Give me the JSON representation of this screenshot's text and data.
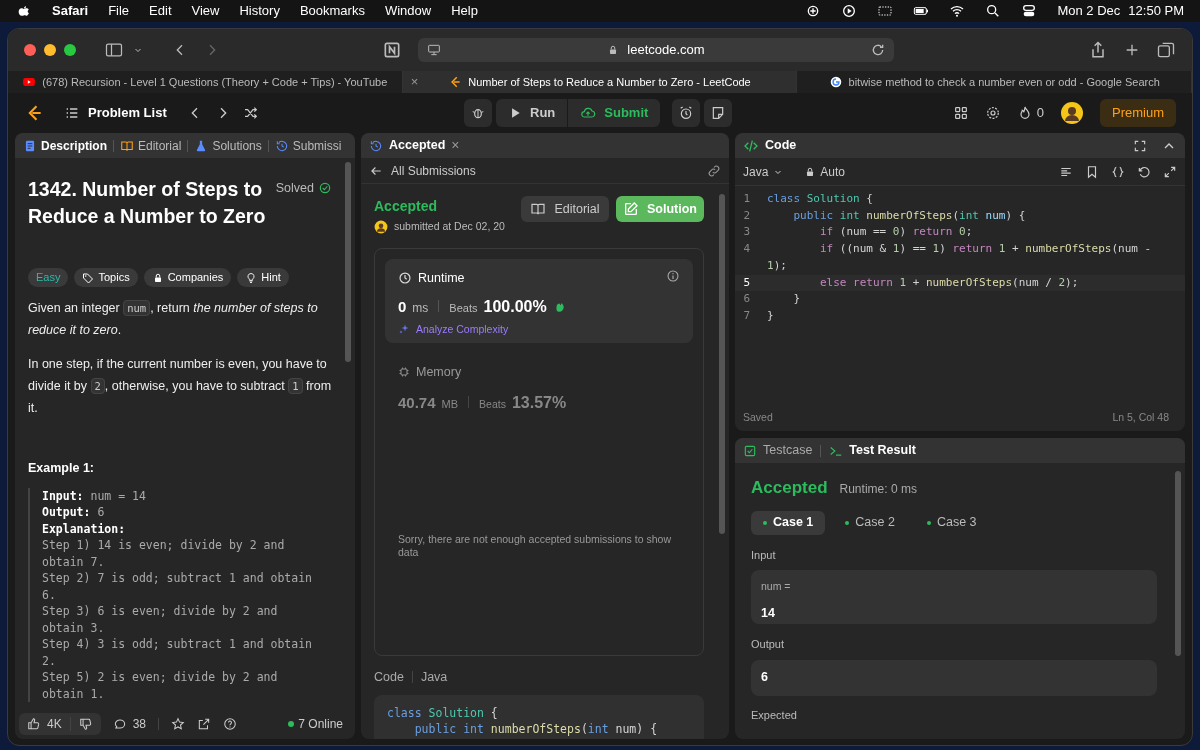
{
  "menu_bar": {
    "app": "Safari",
    "menus": [
      "File",
      "Edit",
      "View",
      "History",
      "Bookmarks",
      "Window",
      "Help"
    ],
    "date": "Mon 2 Dec",
    "time": "12:50 PM"
  },
  "browser": {
    "url": "leetcode.com",
    "tabs": [
      {
        "title": "(678) Recursion - Level 1 Questions (Theory + Code + Tips) - YouTube",
        "selected": false
      },
      {
        "title": "Number of Steps to Reduce a Number to Zero - LeetCode",
        "selected": true,
        "close": "×"
      },
      {
        "title": "bitwise method to check a number even or odd - Google Search",
        "selected": false
      }
    ]
  },
  "nav": {
    "problem_list": "Problem List",
    "run": "Run",
    "submit": "Submit",
    "streak": "0",
    "premium": "Premium"
  },
  "left_panel": {
    "tabs": [
      {
        "label": "Description",
        "selected": true
      },
      {
        "label": "Editorial",
        "selected": false
      },
      {
        "label": "Solutions",
        "selected": false
      },
      {
        "label": "Submissi",
        "selected": false
      }
    ],
    "title": "1342. Number of Steps to Reduce a Number to Zero",
    "status": "Solved",
    "badges": [
      {
        "kind": "difficulty",
        "label": "Easy"
      },
      {
        "kind": "topics",
        "label": "Topics"
      },
      {
        "kind": "companies",
        "label": "Companies"
      },
      {
        "kind": "hint",
        "label": "Hint"
      }
    ],
    "paragraphs": [
      [
        {
          "kind": "text",
          "text": "Given an integer "
        },
        {
          "kind": "code",
          "text": "num"
        },
        {
          "kind": "text",
          "text": ", return *the number of steps to reduce it to zero*."
        }
      ],
      [
        {
          "kind": "text",
          "text": "In one step, if the current number is even, you have to divide it by "
        },
        {
          "kind": "code",
          "text": "2"
        },
        {
          "kind": "text",
          "text": ", otherwise, you have to subtract "
        },
        {
          "kind": "code",
          "text": "1"
        },
        {
          "kind": "text",
          "text": " from it."
        }
      ]
    ],
    "example_title": "Example 1:",
    "example_lines": [
      {
        "label": "Input:",
        "text": " num = 14"
      },
      {
        "label": "Output:",
        "text": " 6"
      },
      {
        "label": "Explanation:"
      },
      {
        "text": "Step 1) 14 is even; divide by 2 and"
      },
      {
        "text": "obtain 7."
      },
      {
        "text": "Step 2) 7 is odd; subtract 1 and obtain"
      },
      {
        "text": "6."
      },
      {
        "text": "Step 3) 6 is even; divide by 2 and"
      },
      {
        "text": "obtain 3."
      },
      {
        "text": "Step 4) 3 is odd; subtract 1 and obtain"
      },
      {
        "text": "2."
      },
      {
        "text": "Step 5) 2 is even; divide by 2 and"
      },
      {
        "text": "obtain 1."
      }
    ],
    "footer": {
      "likes": "4K",
      "comments": "38",
      "online": "7 Online"
    }
  },
  "middle_panel": {
    "tab": "Accepted",
    "close": "×",
    "back": "All Submissions",
    "status": "Accepted",
    "submitted": "submitted at Dec 02, 20",
    "editorial": "Editorial",
    "solution": "Solution",
    "runtime": {
      "title": "Runtime",
      "value": "0",
      "unit": "ms",
      "beats_label": "Beats",
      "beats": "100.00%",
      "analyze": "Analyze Complexity"
    },
    "memory": {
      "title": "Memory",
      "value": "40.74",
      "unit": "MB",
      "beats_label": "Beats",
      "beats": "13.57%"
    },
    "notice": "Sorry, there are not enough accepted submissions to show data",
    "code_label": "Code",
    "language": "Java",
    "code_lines": [
      [
        {
          "kind": "keyword",
          "text": "class "
        },
        {
          "kind": "class",
          "text": "Solution"
        },
        {
          "kind": "plain",
          "text": " {"
        }
      ],
      [
        {
          "kind": "keyword",
          "text": "    public int "
        },
        {
          "kind": "function",
          "text": "numberOfSteps"
        },
        {
          "kind": "plain",
          "text": "("
        },
        {
          "kind": "keyword",
          "text": "int"
        },
        {
          "kind": "plain",
          "text": " num) {"
        }
      ]
    ]
  },
  "editor": {
    "title": "Code",
    "language": "Java",
    "mode": "Auto",
    "saved": "Saved",
    "cursor": "Ln 5, Col 48",
    "lines": [
      {
        "number": "1",
        "tokens": [
          {
            "kind": "keyword",
            "text": "class "
          },
          {
            "kind": "class",
            "text": "Solution"
          },
          {
            "kind": "plain",
            "text": " {"
          }
        ]
      },
      {
        "number": "2",
        "tokens": [
          {
            "kind": "keyword",
            "text": "    public "
          },
          {
            "kind": "class",
            "text": "int "
          },
          {
            "kind": "function",
            "text": "numberOfSteps"
          },
          {
            "kind": "plain",
            "text": "("
          },
          {
            "kind": "class",
            "text": "int "
          },
          {
            "kind": "variable",
            "text": "num"
          },
          {
            "kind": "plain",
            "text": ") {"
          }
        ]
      },
      {
        "number": "3",
        "tokens": [
          {
            "kind": "control",
            "text": "        if"
          },
          {
            "kind": "plain",
            "text": " (num == "
          },
          {
            "kind": "number",
            "text": "0"
          },
          {
            "kind": "plain",
            "text": ") "
          },
          {
            "kind": "control",
            "text": "return "
          },
          {
            "kind": "number",
            "text": "0"
          },
          {
            "kind": "plain",
            "text": ";"
          }
        ]
      },
      {
        "number": "4",
        "tokens": [
          {
            "kind": "control",
            "text": "        if"
          },
          {
            "kind": "plain",
            "text": " ((num & "
          },
          {
            "kind": "number",
            "text": "1"
          },
          {
            "kind": "plain",
            "text": ") == "
          },
          {
            "kind": "number",
            "text": "1"
          },
          {
            "kind": "plain",
            "text": ") "
          },
          {
            "kind": "control",
            "text": "return "
          },
          {
            "kind": "number",
            "text": "1"
          },
          {
            "kind": "plain",
            "text": " + "
          },
          {
            "kind": "function",
            "text": "numberOfSteps"
          },
          {
            "kind": "plain",
            "text": "(num -"
          }
        ],
        "wrap": [
          {
            "kind": "number",
            "text": "1"
          },
          {
            "kind": "plain",
            "text": ");"
          }
        ]
      },
      {
        "number": "5",
        "current": true,
        "tokens": [
          {
            "kind": "control",
            "text": "        else return "
          },
          {
            "kind": "number",
            "text": "1"
          },
          {
            "kind": "plain",
            "text": " + "
          },
          {
            "kind": "function",
            "text": "numberOfSteps"
          },
          {
            "kind": "plain",
            "text": "(num / "
          },
          {
            "kind": "number",
            "text": "2"
          },
          {
            "kind": "plain",
            "text": ");"
          }
        ]
      },
      {
        "number": "6",
        "tokens": [
          {
            "kind": "plain",
            "text": "    }"
          }
        ]
      },
      {
        "number": "7",
        "tokens": [
          {
            "kind": "plain",
            "text": "}"
          }
        ]
      }
    ]
  },
  "results": {
    "tabs": [
      {
        "label": "Testcase",
        "selected": false
      },
      {
        "label": "Test Result",
        "selected": true
      }
    ],
    "status": "Accepted",
    "runtime": "Runtime: 0 ms",
    "cases": [
      {
        "label": "Case 1",
        "selected": true
      },
      {
        "label": "Case 2",
        "selected": false
      },
      {
        "label": "Case 3",
        "selected": false
      }
    ],
    "input_label": "Input",
    "param": "num =",
    "input": "14",
    "output_label": "Output",
    "output": "6",
    "expected_label": "Expected"
  }
}
